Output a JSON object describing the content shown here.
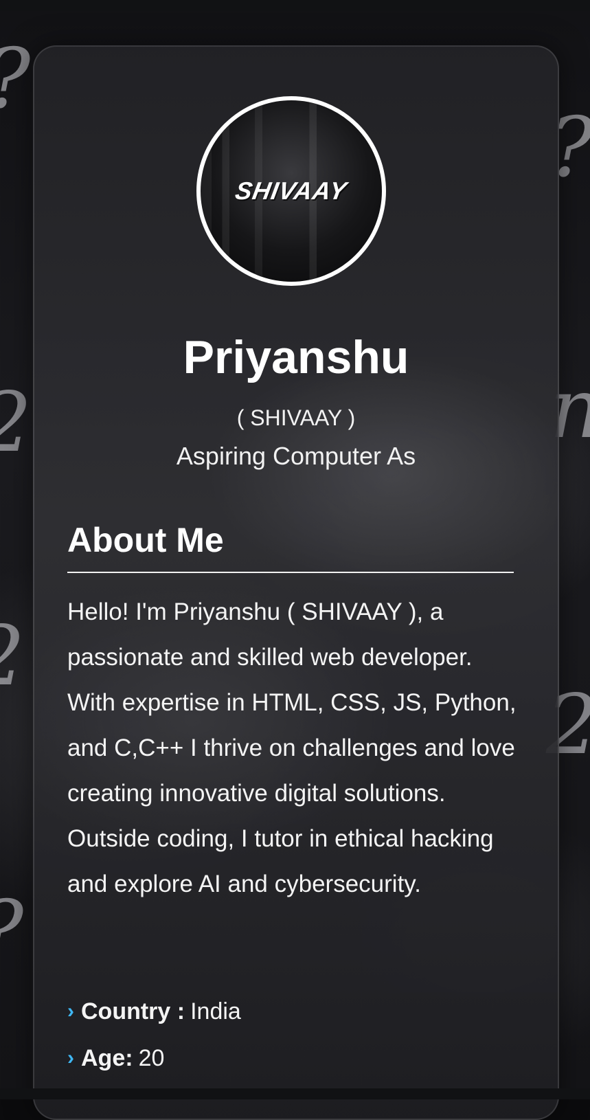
{
  "profile": {
    "avatar_text": "SHIVAAY",
    "name": "Priyanshu",
    "alias": "( SHIVAAY )",
    "tagline": "Aspiring Computer As"
  },
  "about": {
    "title": "About Me",
    "text": "Hello! I'm Priyanshu ( SHIVAAY ), a passionate and skilled web developer. With expertise in HTML, CSS, JS, Python, and C,C++ I thrive on challenges and love creating innovative digital solutions. Outside coding, I tutor in ethical hacking and explore AI and cybersecurity."
  },
  "info": [
    {
      "label": "Country :",
      "value": "India"
    },
    {
      "label": "Age:",
      "value": "20"
    }
  ],
  "colors": {
    "accent": "#3fb6f2",
    "text": "#ffffff",
    "card_border": "#2e2e33"
  },
  "icons": {
    "bullet": "chevron-right-icon"
  }
}
